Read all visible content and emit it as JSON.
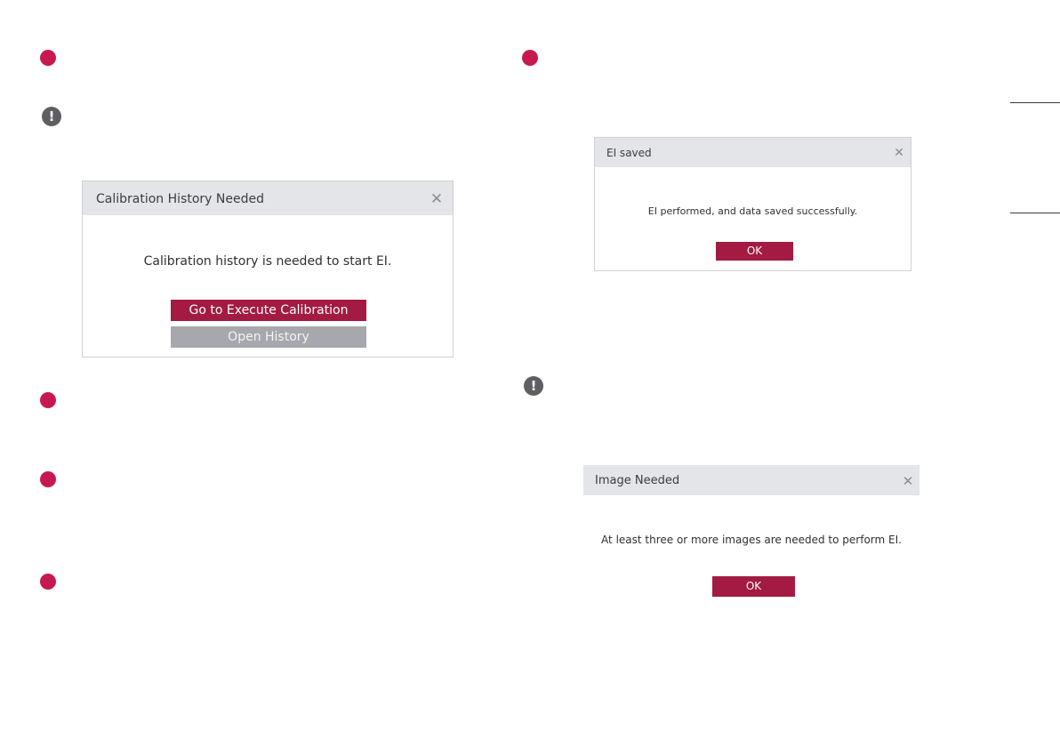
{
  "colors": {
    "accent": "#a31a43",
    "step_dot": "#c8194f",
    "secondary_button": "#a6a8ad",
    "title_bar": "#e3e5e8",
    "note_icon": "#5f5f63"
  },
  "note_glyph": "!",
  "calibration_dialog": {
    "title": "Calibration History Needed",
    "close_glyph": "✕",
    "message": "Calibration history is needed to start EI.",
    "primary_button": "Go to Execute Calibration",
    "secondary_button": "Open History"
  },
  "ei_saved_dialog": {
    "title": "EI saved",
    "close_glyph": "✕",
    "message": "EI performed, and data saved successfully.",
    "ok_button": "OK"
  },
  "image_needed_dialog": {
    "title": "Image Needed",
    "close_glyph": "✕",
    "message": "At least three or more images are needed to perform EI.",
    "ok_button": "OK"
  }
}
